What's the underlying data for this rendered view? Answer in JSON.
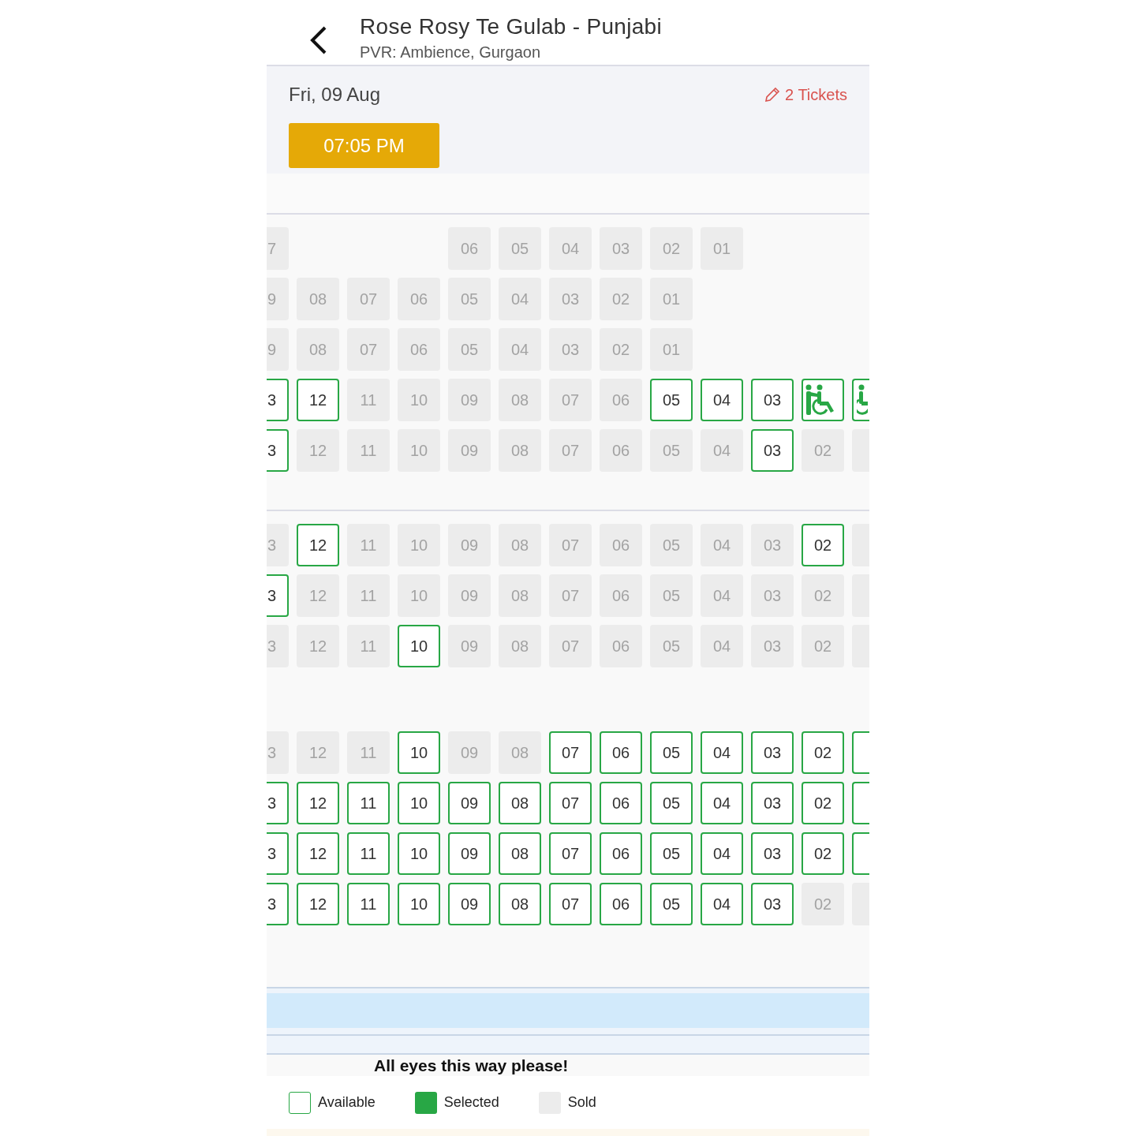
{
  "header": {
    "title": "Rose Rosy Te Gulab - Punjabi",
    "subtitle": "PVR: Ambience, Gurgaon"
  },
  "show": {
    "date": "Fri, 09 Aug",
    "tickets": "2 Tickets",
    "showtimes": [
      {
        "label": "07:05 PM",
        "selected": true
      }
    ]
  },
  "sections": [
    {
      "divider": true,
      "rows": [
        {
          "seats": [
            {
              "kind": "partial-left",
              "label": "7",
              "sold": true
            },
            {
              "kind": "gap"
            },
            {
              "kind": "gap"
            },
            {
              "kind": "gap"
            },
            {
              "kind": "seat",
              "label": "06",
              "sold": true
            },
            {
              "kind": "seat",
              "label": "05",
              "sold": true
            },
            {
              "kind": "seat",
              "label": "04",
              "sold": true
            },
            {
              "kind": "seat",
              "label": "03",
              "sold": true
            },
            {
              "kind": "seat",
              "label": "02",
              "sold": true
            },
            {
              "kind": "seat",
              "label": "01",
              "sold": true
            }
          ]
        },
        {
          "seats": [
            {
              "kind": "partial-left",
              "label": "9",
              "sold": true
            },
            {
              "kind": "seat",
              "label": "08",
              "sold": true
            },
            {
              "kind": "seat",
              "label": "07",
              "sold": true
            },
            {
              "kind": "seat",
              "label": "06",
              "sold": true
            },
            {
              "kind": "seat",
              "label": "05",
              "sold": true
            },
            {
              "kind": "seat",
              "label": "04",
              "sold": true
            },
            {
              "kind": "seat",
              "label": "03",
              "sold": true
            },
            {
              "kind": "seat",
              "label": "02",
              "sold": true
            },
            {
              "kind": "seat",
              "label": "01",
              "sold": true
            }
          ]
        },
        {
          "seats": [
            {
              "kind": "partial-left",
              "label": "9",
              "sold": true
            },
            {
              "kind": "seat",
              "label": "08",
              "sold": true
            },
            {
              "kind": "seat",
              "label": "07",
              "sold": true
            },
            {
              "kind": "seat",
              "label": "06",
              "sold": true
            },
            {
              "kind": "seat",
              "label": "05",
              "sold": true
            },
            {
              "kind": "seat",
              "label": "04",
              "sold": true
            },
            {
              "kind": "seat",
              "label": "03",
              "sold": true
            },
            {
              "kind": "seat",
              "label": "02",
              "sold": true
            },
            {
              "kind": "seat",
              "label": "01",
              "sold": true
            }
          ]
        },
        {
          "seats": [
            {
              "kind": "partial-left",
              "label": "3",
              "sold": false
            },
            {
              "kind": "seat",
              "label": "12",
              "sold": false
            },
            {
              "kind": "seat",
              "label": "11",
              "sold": true
            },
            {
              "kind": "seat",
              "label": "10",
              "sold": true
            },
            {
              "kind": "seat",
              "label": "09",
              "sold": true
            },
            {
              "kind": "seat",
              "label": "08",
              "sold": true
            },
            {
              "kind": "seat",
              "label": "07",
              "sold": true
            },
            {
              "kind": "seat",
              "label": "06",
              "sold": true
            },
            {
              "kind": "seat",
              "label": "05",
              "sold": false
            },
            {
              "kind": "seat",
              "label": "04",
              "sold": false
            },
            {
              "kind": "seat",
              "label": "03",
              "sold": false
            },
            {
              "kind": "companion",
              "sold": false
            },
            {
              "kind": "wheelchair-partial",
              "sold": false
            }
          ]
        },
        {
          "seats": [
            {
              "kind": "partial-left",
              "label": "3",
              "sold": false
            },
            {
              "kind": "seat",
              "label": "12",
              "sold": true
            },
            {
              "kind": "seat",
              "label": "11",
              "sold": true
            },
            {
              "kind": "seat",
              "label": "10",
              "sold": true
            },
            {
              "kind": "seat",
              "label": "09",
              "sold": true
            },
            {
              "kind": "seat",
              "label": "08",
              "sold": true
            },
            {
              "kind": "seat",
              "label": "07",
              "sold": true
            },
            {
              "kind": "seat",
              "label": "06",
              "sold": true
            },
            {
              "kind": "seat",
              "label": "05",
              "sold": true
            },
            {
              "kind": "seat",
              "label": "04",
              "sold": true
            },
            {
              "kind": "seat",
              "label": "03",
              "sold": false
            },
            {
              "kind": "seat",
              "label": "02",
              "sold": true
            },
            {
              "kind": "partial-right",
              "sold": true
            }
          ]
        }
      ]
    },
    {
      "divider": true,
      "rows": [
        {
          "seats": [
            {
              "kind": "partial-left",
              "label": "3",
              "sold": true
            },
            {
              "kind": "seat",
              "label": "12",
              "sold": false
            },
            {
              "kind": "seat",
              "label": "11",
              "sold": true
            },
            {
              "kind": "seat",
              "label": "10",
              "sold": true
            },
            {
              "kind": "seat",
              "label": "09",
              "sold": true
            },
            {
              "kind": "seat",
              "label": "08",
              "sold": true
            },
            {
              "kind": "seat",
              "label": "07",
              "sold": true
            },
            {
              "kind": "seat",
              "label": "06",
              "sold": true
            },
            {
              "kind": "seat",
              "label": "05",
              "sold": true
            },
            {
              "kind": "seat",
              "label": "04",
              "sold": true
            },
            {
              "kind": "seat",
              "label": "03",
              "sold": true
            },
            {
              "kind": "seat",
              "label": "02",
              "sold": false
            },
            {
              "kind": "partial-right",
              "sold": true
            }
          ]
        },
        {
          "seats": [
            {
              "kind": "partial-left",
              "label": "3",
              "sold": false
            },
            {
              "kind": "seat",
              "label": "12",
              "sold": true
            },
            {
              "kind": "seat",
              "label": "11",
              "sold": true
            },
            {
              "kind": "seat",
              "label": "10",
              "sold": true
            },
            {
              "kind": "seat",
              "label": "09",
              "sold": true
            },
            {
              "kind": "seat",
              "label": "08",
              "sold": true
            },
            {
              "kind": "seat",
              "label": "07",
              "sold": true
            },
            {
              "kind": "seat",
              "label": "06",
              "sold": true
            },
            {
              "kind": "seat",
              "label": "05",
              "sold": true
            },
            {
              "kind": "seat",
              "label": "04",
              "sold": true
            },
            {
              "kind": "seat",
              "label": "03",
              "sold": true
            },
            {
              "kind": "seat",
              "label": "02",
              "sold": true
            },
            {
              "kind": "partial-right",
              "sold": true
            }
          ]
        },
        {
          "seats": [
            {
              "kind": "partial-left",
              "label": "3",
              "sold": true
            },
            {
              "kind": "seat",
              "label": "12",
              "sold": true
            },
            {
              "kind": "seat",
              "label": "11",
              "sold": true
            },
            {
              "kind": "seat",
              "label": "10",
              "sold": false
            },
            {
              "kind": "seat",
              "label": "09",
              "sold": true
            },
            {
              "kind": "seat",
              "label": "08",
              "sold": true
            },
            {
              "kind": "seat",
              "label": "07",
              "sold": true
            },
            {
              "kind": "seat",
              "label": "06",
              "sold": true
            },
            {
              "kind": "seat",
              "label": "05",
              "sold": true
            },
            {
              "kind": "seat",
              "label": "04",
              "sold": true
            },
            {
              "kind": "seat",
              "label": "03",
              "sold": true
            },
            {
              "kind": "seat",
              "label": "02",
              "sold": true
            },
            {
              "kind": "partial-right",
              "sold": true
            }
          ]
        }
      ]
    },
    {
      "rows": [
        {
          "seats": [
            {
              "kind": "partial-left",
              "label": "3",
              "sold": true
            },
            {
              "kind": "seat",
              "label": "12",
              "sold": true
            },
            {
              "kind": "seat",
              "label": "11",
              "sold": true
            },
            {
              "kind": "seat",
              "label": "10",
              "sold": false
            },
            {
              "kind": "seat",
              "label": "09",
              "sold": true
            },
            {
              "kind": "seat",
              "label": "08",
              "sold": true
            },
            {
              "kind": "seat",
              "label": "07",
              "sold": false
            },
            {
              "kind": "seat",
              "label": "06",
              "sold": false
            },
            {
              "kind": "seat",
              "label": "05",
              "sold": false
            },
            {
              "kind": "seat",
              "label": "04",
              "sold": false
            },
            {
              "kind": "seat",
              "label": "03",
              "sold": false
            },
            {
              "kind": "seat",
              "label": "02",
              "sold": false
            },
            {
              "kind": "partial-right",
              "sold": false
            }
          ]
        },
        {
          "seats": [
            {
              "kind": "partial-left",
              "label": "3",
              "sold": false
            },
            {
              "kind": "seat",
              "label": "12",
              "sold": false
            },
            {
              "kind": "seat",
              "label": "11",
              "sold": false
            },
            {
              "kind": "seat",
              "label": "10",
              "sold": false
            },
            {
              "kind": "seat",
              "label": "09",
              "sold": false
            },
            {
              "kind": "seat",
              "label": "08",
              "sold": false
            },
            {
              "kind": "seat",
              "label": "07",
              "sold": false
            },
            {
              "kind": "seat",
              "label": "06",
              "sold": false
            },
            {
              "kind": "seat",
              "label": "05",
              "sold": false
            },
            {
              "kind": "seat",
              "label": "04",
              "sold": false
            },
            {
              "kind": "seat",
              "label": "03",
              "sold": false
            },
            {
              "kind": "seat",
              "label": "02",
              "sold": false
            },
            {
              "kind": "partial-right",
              "sold": false
            }
          ]
        },
        {
          "seats": [
            {
              "kind": "partial-left",
              "label": "3",
              "sold": false
            },
            {
              "kind": "seat",
              "label": "12",
              "sold": false
            },
            {
              "kind": "seat",
              "label": "11",
              "sold": false
            },
            {
              "kind": "seat",
              "label": "10",
              "sold": false
            },
            {
              "kind": "seat",
              "label": "09",
              "sold": false
            },
            {
              "kind": "seat",
              "label": "08",
              "sold": false
            },
            {
              "kind": "seat",
              "label": "07",
              "sold": false
            },
            {
              "kind": "seat",
              "label": "06",
              "sold": false
            },
            {
              "kind": "seat",
              "label": "05",
              "sold": false
            },
            {
              "kind": "seat",
              "label": "04",
              "sold": false
            },
            {
              "kind": "seat",
              "label": "03",
              "sold": false
            },
            {
              "kind": "seat",
              "label": "02",
              "sold": false
            },
            {
              "kind": "partial-right",
              "sold": false
            }
          ]
        },
        {
          "seats": [
            {
              "kind": "partial-left",
              "label": "3",
              "sold": false
            },
            {
              "kind": "seat",
              "label": "12",
              "sold": false
            },
            {
              "kind": "seat",
              "label": "11",
              "sold": false
            },
            {
              "kind": "seat",
              "label": "10",
              "sold": false
            },
            {
              "kind": "seat",
              "label": "09",
              "sold": false
            },
            {
              "kind": "seat",
              "label": "08",
              "sold": false
            },
            {
              "kind": "seat",
              "label": "07",
              "sold": false
            },
            {
              "kind": "seat",
              "label": "06",
              "sold": false
            },
            {
              "kind": "seat",
              "label": "05",
              "sold": false
            },
            {
              "kind": "seat",
              "label": "04",
              "sold": false
            },
            {
              "kind": "seat",
              "label": "03",
              "sold": false
            },
            {
              "kind": "seat",
              "label": "02",
              "sold": true
            },
            {
              "kind": "partial-right",
              "sold": true
            }
          ]
        }
      ]
    }
  ],
  "screen": {
    "caption": "All eyes this way please!"
  },
  "legend": [
    {
      "kind": "available",
      "label": "Available"
    },
    {
      "kind": "selected",
      "label": "Selected"
    },
    {
      "kind": "sold",
      "label": "Sold"
    }
  ]
}
